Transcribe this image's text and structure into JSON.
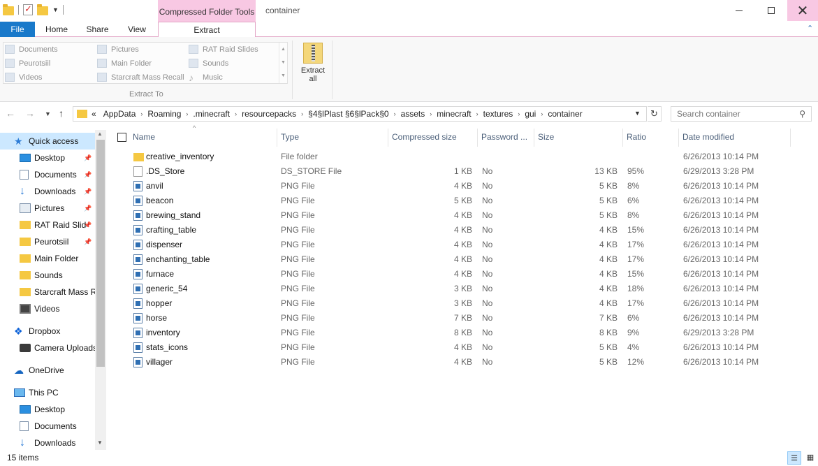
{
  "window": {
    "title": "container",
    "context_tab_group": "Compressed Folder Tools",
    "controls": {
      "minimize": "minimize",
      "maximize": "maximize",
      "close": "✕"
    }
  },
  "ribbon_tabs": [
    "File",
    "Home",
    "Share",
    "View",
    "Extract"
  ],
  "ribbon": {
    "extract_to_items": [
      {
        "label": "Documents",
        "icon": "documents-icon"
      },
      {
        "label": "Peurotsiil",
        "icon": "folder-icon"
      },
      {
        "label": "Videos",
        "icon": "videos-icon"
      },
      {
        "label": "Pictures",
        "icon": "pictures-icon"
      },
      {
        "label": "Main Folder",
        "icon": "folder-icon"
      },
      {
        "label": "Starcraft Mass Recall",
        "icon": "folder-icon"
      },
      {
        "label": "RAT Raid Slides",
        "icon": "folder-icon"
      },
      {
        "label": "Sounds",
        "icon": "folder-icon"
      },
      {
        "label": "Music",
        "icon": "music-icon"
      }
    ],
    "group_label": "Extract To",
    "extract_all_label_1": "Extract",
    "extract_all_label_2": "all"
  },
  "address": {
    "crumbs": [
      "«",
      "AppData",
      "Roaming",
      ".minecraft",
      "resourcepacks",
      "§4§lPlast §6§lPack§0",
      "assets",
      "minecraft",
      "textures",
      "gui",
      "container"
    ],
    "search_placeholder": "Search container"
  },
  "nav": [
    {
      "label": "Quick access",
      "icon": "star",
      "indent": 0,
      "pinned": false,
      "selected": true
    },
    {
      "label": "Desktop",
      "icon": "desk",
      "indent": 1,
      "pinned": true
    },
    {
      "label": "Documents",
      "icon": "docs",
      "indent": 1,
      "pinned": true
    },
    {
      "label": "Downloads",
      "icon": "down",
      "indent": 1,
      "pinned": true
    },
    {
      "label": "Pictures",
      "icon": "pics",
      "indent": 1,
      "pinned": true
    },
    {
      "label": "RAT Raid Slid",
      "icon": "fold",
      "indent": 1,
      "pinned": true
    },
    {
      "label": "Peurotsiil",
      "icon": "fold",
      "indent": 1,
      "pinned": true
    },
    {
      "label": "Main Folder",
      "icon": "fold",
      "indent": 1,
      "pinned": false
    },
    {
      "label": "Sounds",
      "icon": "fold",
      "indent": 1,
      "pinned": false
    },
    {
      "label": "Starcraft Mass Re",
      "icon": "fold",
      "indent": 1,
      "pinned": false
    },
    {
      "label": "Videos",
      "icon": "vids",
      "indent": 1,
      "pinned": false
    },
    {
      "label": "Dropbox",
      "icon": "drop",
      "indent": 0,
      "pinned": false,
      "gap": true
    },
    {
      "label": "Camera Uploads",
      "icon": "cam",
      "indent": 1,
      "pinned": false
    },
    {
      "label": "OneDrive",
      "icon": "cloud",
      "indent": 0,
      "pinned": false,
      "gap": true
    },
    {
      "label": "This PC",
      "icon": "pc",
      "indent": 0,
      "pinned": false,
      "gap": true
    },
    {
      "label": "Desktop",
      "icon": "desk",
      "indent": 1,
      "pinned": false
    },
    {
      "label": "Documents",
      "icon": "docs",
      "indent": 1,
      "pinned": false
    },
    {
      "label": "Downloads",
      "icon": "down",
      "indent": 1,
      "pinned": false
    }
  ],
  "columns": [
    "Name",
    "Type",
    "Compressed size",
    "Password ...",
    "Size",
    "Ratio",
    "Date modified"
  ],
  "files": [
    {
      "name": "creative_inventory",
      "type": "File folder",
      "csize": "",
      "pw": "",
      "size": "",
      "ratio": "",
      "date": "6/26/2013 10:14 PM",
      "icon": "folder"
    },
    {
      "name": ".DS_Store",
      "type": "DS_STORE File",
      "csize": "1 KB",
      "pw": "No",
      "size": "13 KB",
      "ratio": "95%",
      "date": "6/29/2013 3:28 PM",
      "icon": "file"
    },
    {
      "name": "anvil",
      "type": "PNG File",
      "csize": "4 KB",
      "pw": "No",
      "size": "5 KB",
      "ratio": "8%",
      "date": "6/26/2013 10:14 PM",
      "icon": "png"
    },
    {
      "name": "beacon",
      "type": "PNG File",
      "csize": "5 KB",
      "pw": "No",
      "size": "5 KB",
      "ratio": "6%",
      "date": "6/26/2013 10:14 PM",
      "icon": "png"
    },
    {
      "name": "brewing_stand",
      "type": "PNG File",
      "csize": "4 KB",
      "pw": "No",
      "size": "5 KB",
      "ratio": "8%",
      "date": "6/26/2013 10:14 PM",
      "icon": "png"
    },
    {
      "name": "crafting_table",
      "type": "PNG File",
      "csize": "4 KB",
      "pw": "No",
      "size": "4 KB",
      "ratio": "15%",
      "date": "6/26/2013 10:14 PM",
      "icon": "png"
    },
    {
      "name": "dispenser",
      "type": "PNG File",
      "csize": "4 KB",
      "pw": "No",
      "size": "4 KB",
      "ratio": "17%",
      "date": "6/26/2013 10:14 PM",
      "icon": "png"
    },
    {
      "name": "enchanting_table",
      "type": "PNG File",
      "csize": "4 KB",
      "pw": "No",
      "size": "4 KB",
      "ratio": "17%",
      "date": "6/26/2013 10:14 PM",
      "icon": "png"
    },
    {
      "name": "furnace",
      "type": "PNG File",
      "csize": "4 KB",
      "pw": "No",
      "size": "4 KB",
      "ratio": "15%",
      "date": "6/26/2013 10:14 PM",
      "icon": "png"
    },
    {
      "name": "generic_54",
      "type": "PNG File",
      "csize": "3 KB",
      "pw": "No",
      "size": "4 KB",
      "ratio": "18%",
      "date": "6/26/2013 10:14 PM",
      "icon": "png"
    },
    {
      "name": "hopper",
      "type": "PNG File",
      "csize": "3 KB",
      "pw": "No",
      "size": "4 KB",
      "ratio": "17%",
      "date": "6/26/2013 10:14 PM",
      "icon": "png"
    },
    {
      "name": "horse",
      "type": "PNG File",
      "csize": "7 KB",
      "pw": "No",
      "size": "7 KB",
      "ratio": "6%",
      "date": "6/26/2013 10:14 PM",
      "icon": "png"
    },
    {
      "name": "inventory",
      "type": "PNG File",
      "csize": "8 KB",
      "pw": "No",
      "size": "8 KB",
      "ratio": "9%",
      "date": "6/29/2013 3:28 PM",
      "icon": "png"
    },
    {
      "name": "stats_icons",
      "type": "PNG File",
      "csize": "4 KB",
      "pw": "No",
      "size": "5 KB",
      "ratio": "4%",
      "date": "6/26/2013 10:14 PM",
      "icon": "png"
    },
    {
      "name": "villager",
      "type": "PNG File",
      "csize": "4 KB",
      "pw": "No",
      "size": "5 KB",
      "ratio": "12%",
      "date": "6/26/2013 10:14 PM",
      "icon": "png"
    }
  ],
  "status": {
    "count": "15 items"
  },
  "colors": {
    "file_tab": "#1979ca",
    "context_tab": "#f8c8e3",
    "selection": "#cce8ff"
  }
}
